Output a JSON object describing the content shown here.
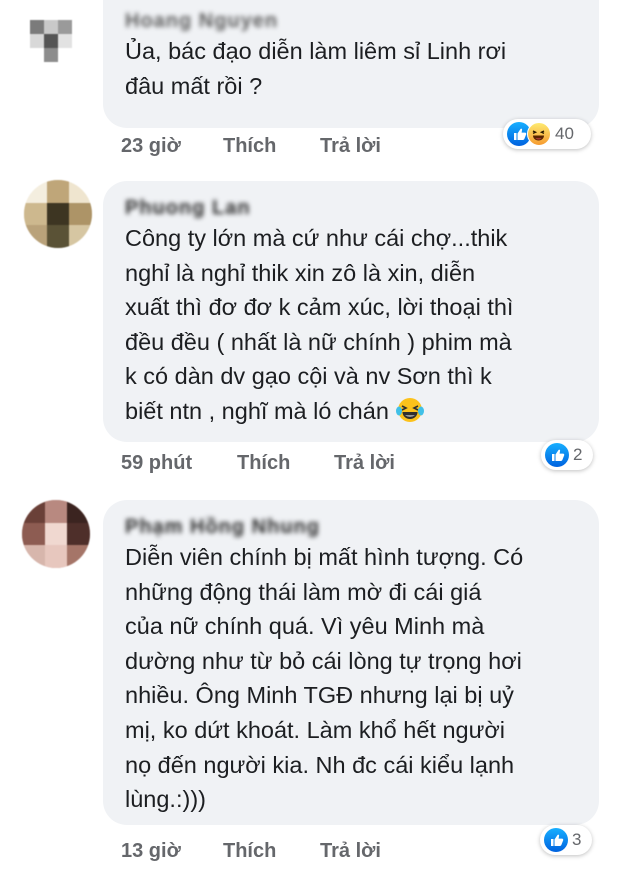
{
  "comments": [
    {
      "author": "Hoang Nguyen",
      "text": "Ủa, bác đạo diễn làm liêm sỉ Linh rơi\nđâu mất rồi ?",
      "time": "23 giờ",
      "like_label": "Thích",
      "reply_label": "Trả lời",
      "reaction_count": "40",
      "reactions": [
        "like-icon",
        "haha-icon"
      ]
    },
    {
      "author": "Phuong Lan",
      "text": "Công ty lớn mà cứ như cái chợ...thik\nnghỉ là nghỉ thik xin zô là xin, diễn\nxuất thì đơ đơ k cảm xúc, lời thoại thì\nđều đều ( nhất là nữ chính ) phim mà\nk có dàn dv gạo cội và nv Sơn thì k\nbiết ntn , nghĩ mà ló chán",
      "text_emoji": "laughing-tears-emoji",
      "time": "59 phút",
      "like_label": "Thích",
      "reply_label": "Trả lời",
      "reaction_count": "2",
      "reactions": [
        "like-icon"
      ]
    },
    {
      "author": "Phạm Hồng Nhung",
      "text": "Diễn viên chính bị mất hình tượng. Có\nnhững động thái làm mờ đi cái giá\ncủa nữ chính quá. Vì yêu Minh mà\ndường như từ bỏ cái lòng tự trọng hơi\nnhiều. Ông Minh TGĐ nhưng lại bị uỷ\nmị, ko dứt khoát. Làm khổ hết người\nnọ đến người kia. Nh đc cái  kiểu lạnh\nlùng.:)))",
      "time": "13 giờ",
      "like_label": "Thích",
      "reply_label": "Trả lời",
      "reaction_count": "3",
      "reactions": [
        "like-icon"
      ]
    }
  ],
  "colors": {
    "bubble": "#f0f2f5",
    "meta_text": "#65676b",
    "like_blue": "#1877f2"
  }
}
